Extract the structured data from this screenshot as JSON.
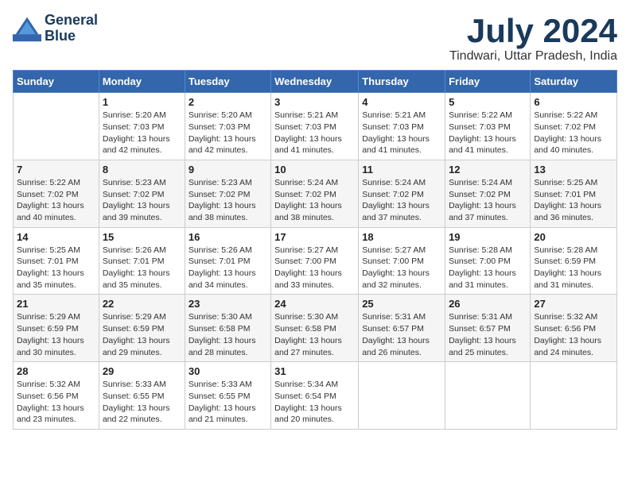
{
  "logo": {
    "line1": "General",
    "line2": "Blue"
  },
  "title": "July 2024",
  "location": "Tindwari, Uttar Pradesh, India",
  "weekdays": [
    "Sunday",
    "Monday",
    "Tuesday",
    "Wednesday",
    "Thursday",
    "Friday",
    "Saturday"
  ],
  "weeks": [
    [
      {
        "day": "",
        "sunrise": "",
        "sunset": "",
        "daylight": ""
      },
      {
        "day": "1",
        "sunrise": "Sunrise: 5:20 AM",
        "sunset": "Sunset: 7:03 PM",
        "daylight": "Daylight: 13 hours and 42 minutes."
      },
      {
        "day": "2",
        "sunrise": "Sunrise: 5:20 AM",
        "sunset": "Sunset: 7:03 PM",
        "daylight": "Daylight: 13 hours and 42 minutes."
      },
      {
        "day": "3",
        "sunrise": "Sunrise: 5:21 AM",
        "sunset": "Sunset: 7:03 PM",
        "daylight": "Daylight: 13 hours and 41 minutes."
      },
      {
        "day": "4",
        "sunrise": "Sunrise: 5:21 AM",
        "sunset": "Sunset: 7:03 PM",
        "daylight": "Daylight: 13 hours and 41 minutes."
      },
      {
        "day": "5",
        "sunrise": "Sunrise: 5:22 AM",
        "sunset": "Sunset: 7:03 PM",
        "daylight": "Daylight: 13 hours and 41 minutes."
      },
      {
        "day": "6",
        "sunrise": "Sunrise: 5:22 AM",
        "sunset": "Sunset: 7:02 PM",
        "daylight": "Daylight: 13 hours and 40 minutes."
      }
    ],
    [
      {
        "day": "7",
        "sunrise": "Sunrise: 5:22 AM",
        "sunset": "Sunset: 7:02 PM",
        "daylight": "Daylight: 13 hours and 40 minutes."
      },
      {
        "day": "8",
        "sunrise": "Sunrise: 5:23 AM",
        "sunset": "Sunset: 7:02 PM",
        "daylight": "Daylight: 13 hours and 39 minutes."
      },
      {
        "day": "9",
        "sunrise": "Sunrise: 5:23 AM",
        "sunset": "Sunset: 7:02 PM",
        "daylight": "Daylight: 13 hours and 38 minutes."
      },
      {
        "day": "10",
        "sunrise": "Sunrise: 5:24 AM",
        "sunset": "Sunset: 7:02 PM",
        "daylight": "Daylight: 13 hours and 38 minutes."
      },
      {
        "day": "11",
        "sunrise": "Sunrise: 5:24 AM",
        "sunset": "Sunset: 7:02 PM",
        "daylight": "Daylight: 13 hours and 37 minutes."
      },
      {
        "day": "12",
        "sunrise": "Sunrise: 5:24 AM",
        "sunset": "Sunset: 7:02 PM",
        "daylight": "Daylight: 13 hours and 37 minutes."
      },
      {
        "day": "13",
        "sunrise": "Sunrise: 5:25 AM",
        "sunset": "Sunset: 7:01 PM",
        "daylight": "Daylight: 13 hours and 36 minutes."
      }
    ],
    [
      {
        "day": "14",
        "sunrise": "Sunrise: 5:25 AM",
        "sunset": "Sunset: 7:01 PM",
        "daylight": "Daylight: 13 hours and 35 minutes."
      },
      {
        "day": "15",
        "sunrise": "Sunrise: 5:26 AM",
        "sunset": "Sunset: 7:01 PM",
        "daylight": "Daylight: 13 hours and 35 minutes."
      },
      {
        "day": "16",
        "sunrise": "Sunrise: 5:26 AM",
        "sunset": "Sunset: 7:01 PM",
        "daylight": "Daylight: 13 hours and 34 minutes."
      },
      {
        "day": "17",
        "sunrise": "Sunrise: 5:27 AM",
        "sunset": "Sunset: 7:00 PM",
        "daylight": "Daylight: 13 hours and 33 minutes."
      },
      {
        "day": "18",
        "sunrise": "Sunrise: 5:27 AM",
        "sunset": "Sunset: 7:00 PM",
        "daylight": "Daylight: 13 hours and 32 minutes."
      },
      {
        "day": "19",
        "sunrise": "Sunrise: 5:28 AM",
        "sunset": "Sunset: 7:00 PM",
        "daylight": "Daylight: 13 hours and 31 minutes."
      },
      {
        "day": "20",
        "sunrise": "Sunrise: 5:28 AM",
        "sunset": "Sunset: 6:59 PM",
        "daylight": "Daylight: 13 hours and 31 minutes."
      }
    ],
    [
      {
        "day": "21",
        "sunrise": "Sunrise: 5:29 AM",
        "sunset": "Sunset: 6:59 PM",
        "daylight": "Daylight: 13 hours and 30 minutes."
      },
      {
        "day": "22",
        "sunrise": "Sunrise: 5:29 AM",
        "sunset": "Sunset: 6:59 PM",
        "daylight": "Daylight: 13 hours and 29 minutes."
      },
      {
        "day": "23",
        "sunrise": "Sunrise: 5:30 AM",
        "sunset": "Sunset: 6:58 PM",
        "daylight": "Daylight: 13 hours and 28 minutes."
      },
      {
        "day": "24",
        "sunrise": "Sunrise: 5:30 AM",
        "sunset": "Sunset: 6:58 PM",
        "daylight": "Daylight: 13 hours and 27 minutes."
      },
      {
        "day": "25",
        "sunrise": "Sunrise: 5:31 AM",
        "sunset": "Sunset: 6:57 PM",
        "daylight": "Daylight: 13 hours and 26 minutes."
      },
      {
        "day": "26",
        "sunrise": "Sunrise: 5:31 AM",
        "sunset": "Sunset: 6:57 PM",
        "daylight": "Daylight: 13 hours and 25 minutes."
      },
      {
        "day": "27",
        "sunrise": "Sunrise: 5:32 AM",
        "sunset": "Sunset: 6:56 PM",
        "daylight": "Daylight: 13 hours and 24 minutes."
      }
    ],
    [
      {
        "day": "28",
        "sunrise": "Sunrise: 5:32 AM",
        "sunset": "Sunset: 6:56 PM",
        "daylight": "Daylight: 13 hours and 23 minutes."
      },
      {
        "day": "29",
        "sunrise": "Sunrise: 5:33 AM",
        "sunset": "Sunset: 6:55 PM",
        "daylight": "Daylight: 13 hours and 22 minutes."
      },
      {
        "day": "30",
        "sunrise": "Sunrise: 5:33 AM",
        "sunset": "Sunset: 6:55 PM",
        "daylight": "Daylight: 13 hours and 21 minutes."
      },
      {
        "day": "31",
        "sunrise": "Sunrise: 5:34 AM",
        "sunset": "Sunset: 6:54 PM",
        "daylight": "Daylight: 13 hours and 20 minutes."
      },
      {
        "day": "",
        "sunrise": "",
        "sunset": "",
        "daylight": ""
      },
      {
        "day": "",
        "sunrise": "",
        "sunset": "",
        "daylight": ""
      },
      {
        "day": "",
        "sunrise": "",
        "sunset": "",
        "daylight": ""
      }
    ]
  ]
}
